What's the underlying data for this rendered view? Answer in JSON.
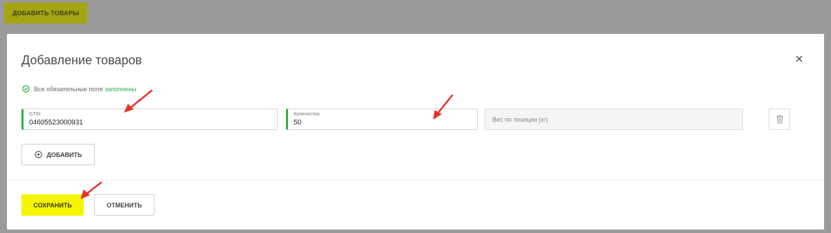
{
  "page": {
    "add_goods_button": "ДОБАВИТЬ ТОВАРЫ"
  },
  "modal": {
    "title": "Добавление товаров",
    "status": {
      "text": "Все обязательные поля",
      "highlight": "заполнены",
      "color": "#2bb34a"
    },
    "fields": {
      "gtin": {
        "label": "GTIN",
        "value": "04605523000931"
      },
      "quantity": {
        "label": "Количество",
        "value": "50"
      },
      "weight": {
        "placeholder": "Вес по позиции (кг)"
      }
    },
    "add_button": "ДОБАВИТЬ",
    "save_button": "СОХРАНИТЬ",
    "cancel_button": "ОТМЕНИТЬ"
  },
  "colors": {
    "accent_yellow": "#f5f500",
    "valid_green": "#2bb34a",
    "annotation_red": "#e8302a"
  }
}
